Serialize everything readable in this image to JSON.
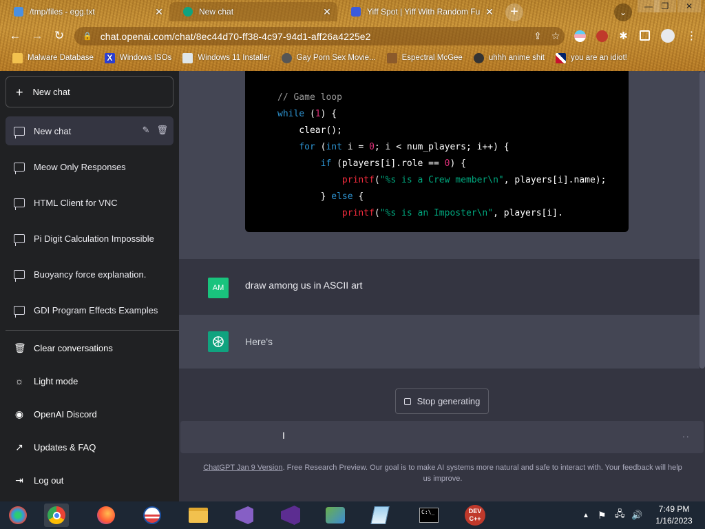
{
  "browser": {
    "tabs": [
      {
        "title": "/tmp/files - egg.txt",
        "icon": "doc-icon",
        "color": "#4a90e2"
      },
      {
        "title": "New chat",
        "icon": "openai-icon",
        "color": "#10a37f",
        "active": true
      },
      {
        "title": "Yiff Spot | Yiff With Random Fu",
        "icon": "site-icon",
        "color": "#3b5bdb"
      }
    ],
    "new_tab": "+",
    "tab_search": "⌄",
    "window_controls": {
      "minimize": "—",
      "restore": "❐",
      "close": "✕"
    },
    "url": "chat.openai.com/chat/8ec44d70-ff38-4c97-94d1-aff26a4225e2",
    "bookmarks": [
      {
        "label": "Malware Database",
        "icon": "folder-icon"
      },
      {
        "label": "Windows ISOs",
        "icon": "x-icon"
      },
      {
        "label": "Windows 11 Installer",
        "icon": "image-icon"
      },
      {
        "label": "Gay Porn Sex Movie...",
        "icon": "site-icon"
      },
      {
        "label": "Espectral McGee",
        "icon": "site-icon"
      },
      {
        "label": "uhhh anime shit",
        "icon": "site-icon"
      },
      {
        "label": "you are an idiot!",
        "icon": "flag-icon"
      }
    ]
  },
  "sidebar": {
    "new_chat": "New chat",
    "conversations": [
      {
        "label": "New chat",
        "active": true
      },
      {
        "label": "Meow Only Responses"
      },
      {
        "label": "HTML Client for VNC"
      },
      {
        "label": "Pi Digit Calculation Impossible"
      },
      {
        "label": "Buoyancy force explanation."
      },
      {
        "label": "GDI Program Effects Examples"
      }
    ],
    "menu": [
      {
        "label": "Clear conversations",
        "icon": "trash-icon"
      },
      {
        "label": "Light mode",
        "icon": "sun-icon"
      },
      {
        "label": "OpenAI Discord",
        "icon": "discord-icon"
      },
      {
        "label": "Updates & FAQ",
        "icon": "external-link-icon"
      },
      {
        "label": "Log out",
        "icon": "logout-icon"
      }
    ]
  },
  "chat": {
    "code_lines": [
      "// Game loop",
      "while (1) {",
      "    clear();",
      "    for (int i = 0; i < num_players; i++) {",
      "        if (players[i].role == 0) {",
      "            printf(\"%s is a Crew member\\n\", players[i].name);",
      "        } else {",
      "            printf(\"%s is an Imposter\\n\", players[i]."
    ],
    "user_avatar": "AM",
    "user_message": "draw among us in ASCII art",
    "assistant_message": "Here's",
    "stop_button": "Stop generating",
    "input_value": "",
    "footer_link": "ChatGPT Jan 9 Version",
    "footer_text": ". Free Research Preview. Our goal is to make AI systems more natural and safe to interact with. Your feedback will help us improve."
  },
  "taskbar": {
    "apps": [
      "start",
      "chrome",
      "firefox",
      "obama",
      "file-explorer",
      "visual-studio-installer",
      "visual-studio",
      "network-app",
      "notepad",
      "terminal",
      "dev-cpp"
    ],
    "time": "7:49 PM",
    "date": "1/16/2023"
  }
}
